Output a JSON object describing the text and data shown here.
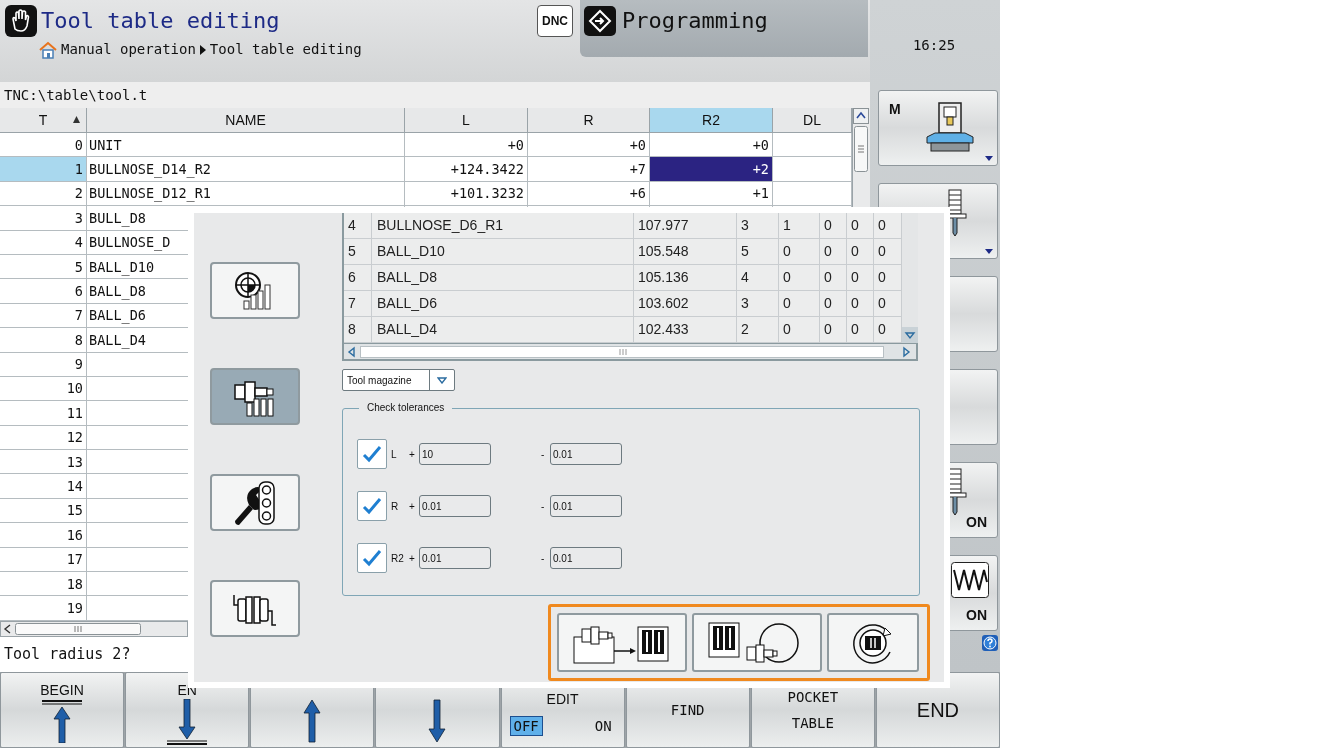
{
  "header": {
    "title": "Tool table editing",
    "breadcrumb": [
      "Manual operation",
      "Tool table editing"
    ],
    "dnc_label": "DNC",
    "mode_tab": "Programming",
    "clock": "16:25"
  },
  "path": "TNC:\\table\\tool.t",
  "tool_table": {
    "columns": [
      {
        "label": "T",
        "sorted": true,
        "selected": false
      },
      {
        "label": "NAME",
        "sorted": false,
        "selected": false
      },
      {
        "label": "L",
        "sorted": false,
        "selected": false
      },
      {
        "label": "R",
        "sorted": false,
        "selected": false
      },
      {
        "label": "R2",
        "sorted": false,
        "selected": true
      },
      {
        "label": "DL",
        "sorted": false,
        "selected": false
      }
    ],
    "rows": [
      {
        "cells": [
          "0",
          "UNIT",
          "+0",
          "+0",
          "+0"
        ],
        "selected": false
      },
      {
        "cells": [
          "1",
          "BULLNOSE_D14_R2",
          "+124.3422",
          "+7",
          "+2"
        ],
        "selected": true
      },
      {
        "cells": [
          "2",
          "BULLNOSE_D12_R1",
          "+101.3232",
          "+6",
          "+1"
        ],
        "selected": false
      },
      {
        "cells": [
          "3",
          "BULL_D8"
        ],
        "selected": false
      },
      {
        "cells": [
          "4",
          "BULLNOSE_D"
        ],
        "selected": false
      },
      {
        "cells": [
          "5",
          "BALL_D10"
        ],
        "selected": false
      },
      {
        "cells": [
          "6",
          "BALL_D8"
        ],
        "selected": false
      },
      {
        "cells": [
          "7",
          "BALL_D6"
        ],
        "selected": false
      },
      {
        "cells": [
          "8",
          "BALL_D4"
        ],
        "selected": false
      },
      {
        "cells": [
          "9"
        ],
        "selected": false
      },
      {
        "cells": [
          "10"
        ],
        "selected": false
      },
      {
        "cells": [
          "11"
        ],
        "selected": false
      },
      {
        "cells": [
          "12"
        ],
        "selected": false
      },
      {
        "cells": [
          "13"
        ],
        "selected": false
      },
      {
        "cells": [
          "14"
        ],
        "selected": false
      },
      {
        "cells": [
          "15"
        ],
        "selected": false
      },
      {
        "cells": [
          "16"
        ],
        "selected": false
      },
      {
        "cells": [
          "17"
        ],
        "selected": false
      },
      {
        "cells": [
          "18"
        ],
        "selected": false
      },
      {
        "cells": [
          "19"
        ],
        "selected": false
      }
    ]
  },
  "prompt": "Tool radius 2?",
  "softkeys_right": [
    {
      "kind": "machine",
      "label": "M",
      "menu": true
    },
    {
      "kind": "tool",
      "menu": true
    },
    {
      "kind": "blank",
      "menu": false
    },
    {
      "kind": "blank",
      "menu": false
    },
    {
      "kind": "tool",
      "label": "ON",
      "menu": false
    },
    {
      "kind": "wave",
      "label": "ON",
      "menu": false
    }
  ],
  "softkeys_bottom": [
    {
      "kind": "begin",
      "label": "BEGIN"
    },
    {
      "kind": "end",
      "label": "EN"
    },
    {
      "kind": "pageup"
    },
    {
      "kind": "pagedown"
    },
    {
      "kind": "toggle",
      "label": "EDIT",
      "options": [
        {
          "label": "OFF",
          "selected": true
        },
        {
          "label": "ON",
          "selected": false
        }
      ]
    },
    {
      "kind": "text",
      "lines": [
        "FIND"
      ]
    },
    {
      "kind": "text",
      "lines": [
        "POCKET",
        "TABLE"
      ]
    },
    {
      "kind": "big",
      "label": "END"
    }
  ],
  "dialog": {
    "side_buttons": [
      {
        "selected": false
      },
      {
        "selected": true
      },
      {
        "selected": false
      },
      {
        "selected": false
      }
    ],
    "table_rows": [
      [
        "4",
        "BULLNOSE_D6_R1",
        "107.977",
        "3",
        "1",
        "0",
        "0",
        "0"
      ],
      [
        "5",
        "BALL_D10",
        "105.548",
        "5",
        "0",
        "0",
        "0",
        "0"
      ],
      [
        "6",
        "BALL_D8",
        "105.136",
        "4",
        "0",
        "0",
        "0",
        "0"
      ],
      [
        "7",
        "BALL_D6",
        "103.602",
        "3",
        "0",
        "0",
        "0",
        "0"
      ],
      [
        "8",
        "BALL_D4",
        "102.433",
        "2",
        "0",
        "0",
        "0",
        "0"
      ]
    ],
    "dropdown": "Tool magazine",
    "tolerances": {
      "title": "Check tolerances",
      "rows": [
        {
          "label": "L",
          "checked": true,
          "plus_sign": "+",
          "plus": "10",
          "minus_sign": "-",
          "minus": "0.01"
        },
        {
          "label": "R",
          "checked": true,
          "plus_sign": "+",
          "plus": "0.01",
          "minus_sign": "-",
          "minus": "0.01"
        },
        {
          "label": "R2",
          "checked": true,
          "plus_sign": "+",
          "plus": "0.01",
          "minus_sign": "-",
          "minus": "0.01"
        }
      ]
    }
  }
}
